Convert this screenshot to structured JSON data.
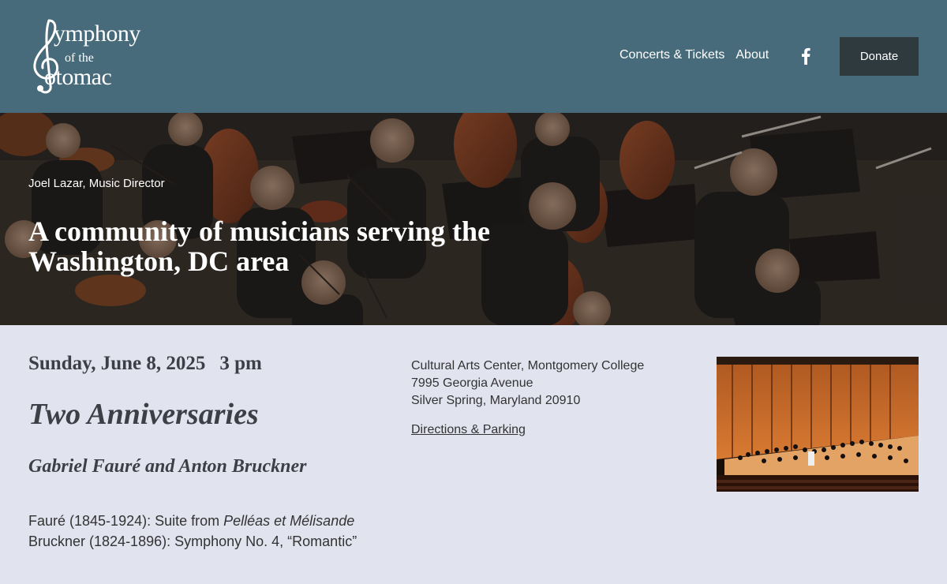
{
  "header": {
    "logo": {
      "line1": "ymphony",
      "line2": "of the",
      "line3": "otomac"
    },
    "nav": [
      {
        "label": "Concerts & Tickets"
      },
      {
        "label": "About"
      }
    ],
    "facebook_icon": "facebook-icon",
    "donate_label": "Donate",
    "background_color": "#476b7b"
  },
  "hero": {
    "subtitle": "Joel Lazar, Music Director",
    "title": "A community of musicians serving the Washington, DC area"
  },
  "concert": {
    "date": "Sunday, June 8, 2025",
    "time": "3 pm",
    "title": "Two Anniversaries",
    "composers": "Gabriel Fauré and Anton Bruckner",
    "program": {
      "item1_prefix": "Fauré (1845-1924): Suite from ",
      "item1_work": "Pelléas et Mélisande",
      "item2_prefix": "Bruckner (1824-1896): Symphony No. 4, ",
      "item2_work": "“Romantic”"
    }
  },
  "venue": {
    "name": "Cultural Arts Center, Montgomery College",
    "street": "7995 Georgia Avenue",
    "city": "Silver Spring, Maryland 20910",
    "directions_label": "Directions & Parking"
  },
  "colors": {
    "page_background": "#e1e3ef",
    "donate_button": "#2f3a3f"
  }
}
